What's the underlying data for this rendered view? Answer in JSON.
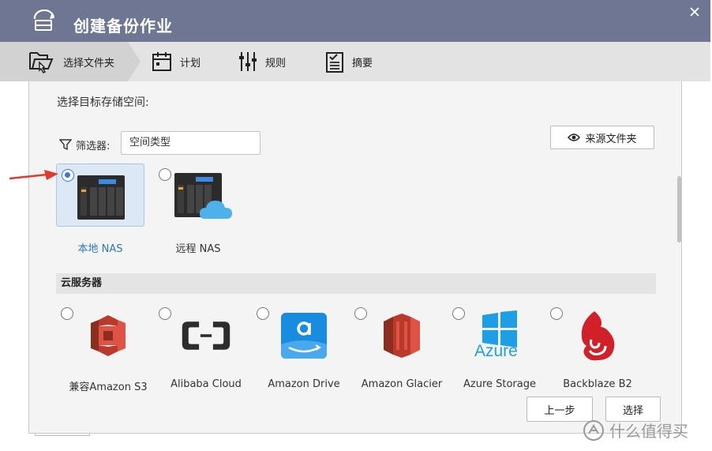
{
  "window": {
    "title": "创建备份作业",
    "close_icon": "close-icon",
    "title_icon": "backup-job-icon"
  },
  "steps": [
    {
      "label": "选择文件夹",
      "icon": "folder-select-icon",
      "active": true
    },
    {
      "label": "计划",
      "icon": "calendar-icon",
      "active": false
    },
    {
      "label": "规则",
      "icon": "sliders-icon",
      "active": false
    },
    {
      "label": "摘要",
      "icon": "clipboard-icon",
      "active": false
    }
  ],
  "content": {
    "prompt": "选择目标存储空间:",
    "filter": {
      "label": "筛选器:",
      "value": "空间类型",
      "icon": "filter-icon"
    },
    "source_button": {
      "label": "来源文件夹",
      "icon": "eye-icon"
    },
    "nas_options": [
      {
        "label": "本地 NAS",
        "selected": true,
        "icon": "nas-device-icon"
      },
      {
        "label": "远程 NAS",
        "selected": false,
        "icon": "remote-nas-cloud-icon"
      }
    ],
    "cloud_section": {
      "title": "云服务器",
      "items": [
        {
          "label": "兼容Amazon S3",
          "icon": "amazon-s3-icon"
        },
        {
          "label": "Alibaba Cloud",
          "icon": "alibaba-cloud-icon"
        },
        {
          "label": "Amazon Drive",
          "icon": "amazon-drive-icon"
        },
        {
          "label": "Amazon Glacier",
          "icon": "amazon-glacier-icon"
        },
        {
          "label": "Azure Storage",
          "icon": "azure-icon",
          "logo_text": "Azure"
        },
        {
          "label": "Backblaze B2",
          "icon": "backblaze-icon"
        }
      ]
    }
  },
  "buttons": {
    "prev": "上一步",
    "select": "选择"
  },
  "watermark": {
    "text": "什么值得买",
    "icon": "smzdm-logo"
  },
  "colors": {
    "titlebar": "#6e7693",
    "selected_bg": "#dce8f6",
    "selected_text": "#2a7ab8",
    "radio_accent": "#3a78d8",
    "annotation_arrow": "#e03a2f"
  }
}
